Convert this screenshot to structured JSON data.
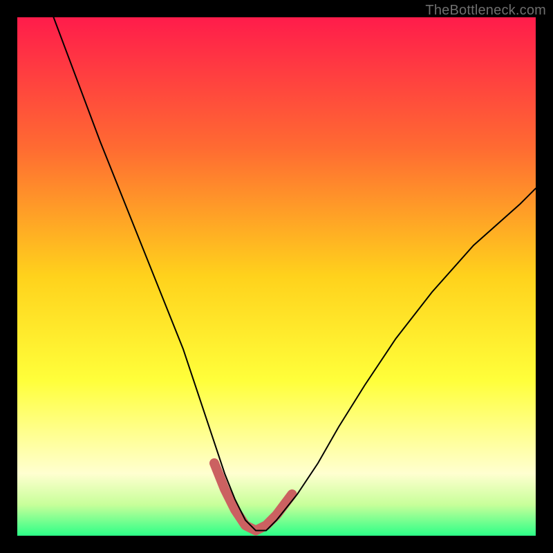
{
  "watermark": "TheBottleneck.com",
  "chart_data": {
    "type": "line",
    "title": "",
    "xlabel": "",
    "ylabel": "",
    "xlim": [
      0,
      100
    ],
    "ylim": [
      0,
      100
    ],
    "legend": false,
    "grid": false,
    "background_gradient": {
      "direction": "vertical",
      "stops": [
        {
          "y": 0,
          "color": "#ff1c4b"
        },
        {
          "y": 25,
          "color": "#ff6a32"
        },
        {
          "y": 50,
          "color": "#ffd21c"
        },
        {
          "y": 70,
          "color": "#ffff3a"
        },
        {
          "y": 88,
          "color": "#ffffd0"
        },
        {
          "y": 94,
          "color": "#c8ff9a"
        },
        {
          "y": 100,
          "color": "#2cff87"
        }
      ]
    },
    "series": [
      {
        "name": "bottleneck-curve",
        "color": "#000000",
        "x": [
          7,
          10,
          13,
          16,
          20,
          24,
          28,
          32,
          35,
          38,
          40,
          42,
          44,
          46,
          48,
          50,
          54,
          58,
          62,
          67,
          73,
          80,
          88,
          97,
          100
        ],
        "y": [
          100,
          92,
          84,
          76,
          66,
          56,
          46,
          36,
          27,
          18,
          12,
          7,
          3,
          1,
          1,
          3,
          8,
          14,
          21,
          29,
          38,
          47,
          56,
          64,
          67
        ]
      }
    ],
    "highlight_segment": {
      "name": "optimal-zone",
      "color": "#cb6161",
      "x": [
        38,
        40,
        42,
        44,
        46,
        48,
        50,
        53
      ],
      "y": [
        14,
        9,
        5,
        2,
        1,
        2,
        4,
        8
      ]
    }
  }
}
